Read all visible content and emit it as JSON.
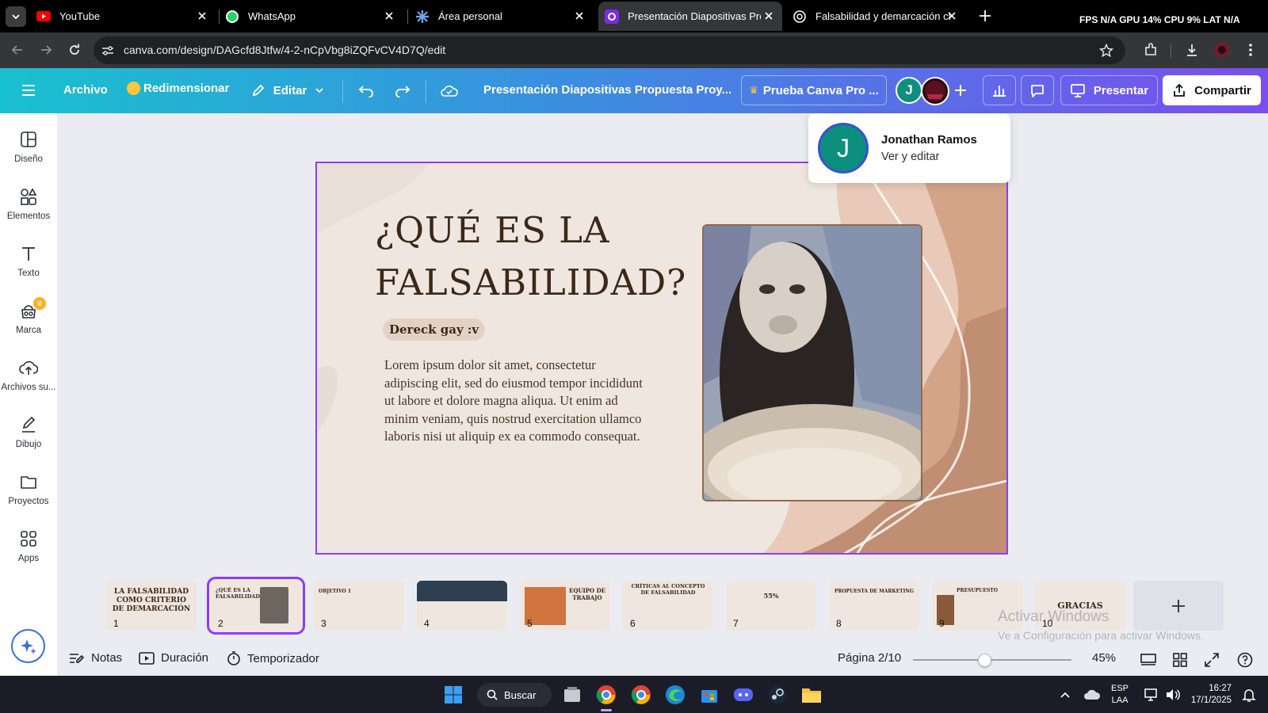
{
  "browser": {
    "tabs": [
      {
        "title": "YouTube",
        "icon": "youtube-icon"
      },
      {
        "title": "WhatsApp",
        "icon": "whatsapp-icon"
      },
      {
        "title": "Área personal",
        "icon": "moodle-icon"
      },
      {
        "title": "Presentación Diapositivas Propu",
        "icon": "canva-icon",
        "active": true
      },
      {
        "title": "Falsabilidad y demarcación cien",
        "icon": "openai-icon"
      }
    ],
    "url": "canva.com/design/DAGcfd8Jtfw/4-2-nCpVbg8iZQFvCV4D7Q/edit",
    "perf_overlay": "FPS N/A GPU 14% CPU 9% LAT N/A"
  },
  "canva_header": {
    "file_label": "Archivo",
    "resize_label": "Redimensionar",
    "edit_label": "Editar",
    "doc_title": "Presentación Diapositivas Propuesta Proy...",
    "pro_trial_label": "Prueba Canva Pro ...",
    "avatar_initial": "J",
    "present_label": "Presentar",
    "share_label": "Compartir"
  },
  "sidebar": {
    "items": [
      {
        "label": "Diseño",
        "icon": "design-icon"
      },
      {
        "label": "Elementos",
        "icon": "elements-icon"
      },
      {
        "label": "Texto",
        "icon": "text-icon"
      },
      {
        "label": "Marca",
        "icon": "brand-icon"
      },
      {
        "label": "Archivos su...",
        "icon": "upload-icon"
      },
      {
        "label": "Dibujo",
        "icon": "draw-icon"
      },
      {
        "label": "Proyectos",
        "icon": "folder-icon"
      },
      {
        "label": "Apps",
        "icon": "apps-icon"
      }
    ]
  },
  "popover": {
    "initial": "J",
    "name": "Jonathan Ramos",
    "role": "Ver y editar"
  },
  "slide": {
    "title_line1": "¿QUÉ ES LA",
    "title_line2": "FALSABILIDAD?",
    "pill": "Dereck gay :v",
    "body": "Lorem ipsum dolor sit amet, consectetur adipiscing elit, sed do eiusmod tempor incididunt ut labore et dolore magna aliqua. Ut enim ad minim veniam, quis nostrud exercitation ullamco laboris nisi ut aliquip ex ea commodo consequat."
  },
  "thumbnails": [
    {
      "num": "1",
      "title": "LA FALSABILIDAD COMO CRITERIO DE DEMARCACIÓN"
    },
    {
      "num": "2",
      "title": "¿QUÉ ES LA FALSABILIDAD?"
    },
    {
      "num": "3",
      "title": "OBJETIVO 1"
    },
    {
      "num": "4",
      "title": ""
    },
    {
      "num": "5",
      "title": "EQUIPO DE TRABAJO"
    },
    {
      "num": "6",
      "title": "CRÍTICAS AL CONCEPTO DE FALSABILIDAD"
    },
    {
      "num": "7",
      "title": "55%"
    },
    {
      "num": "8",
      "title": "PROPUESTA DE MARKETING"
    },
    {
      "num": "9",
      "title": "PRESUPUESTO"
    },
    {
      "num": "10",
      "title": "GRACIAS"
    }
  ],
  "bottombar": {
    "notes_label": "Notas",
    "duration_label": "Duración",
    "timer_label": "Temporizador",
    "page_label": "Página 2/10",
    "zoom_label": "45%",
    "zoom_fraction": 0.45
  },
  "watermark": {
    "line1": "Activar Windows",
    "line2": "Ve a Configuración para activar Windows."
  },
  "taskbar": {
    "search_label": "Buscar",
    "lang_line1": "ESP",
    "lang_line2": "LAA",
    "time": "16:27",
    "date": "17/1/2025"
  },
  "colors": {
    "canva_purple": "#8b3dff",
    "slide_bg": "#efe6df",
    "slide_text": "#3b2818"
  }
}
